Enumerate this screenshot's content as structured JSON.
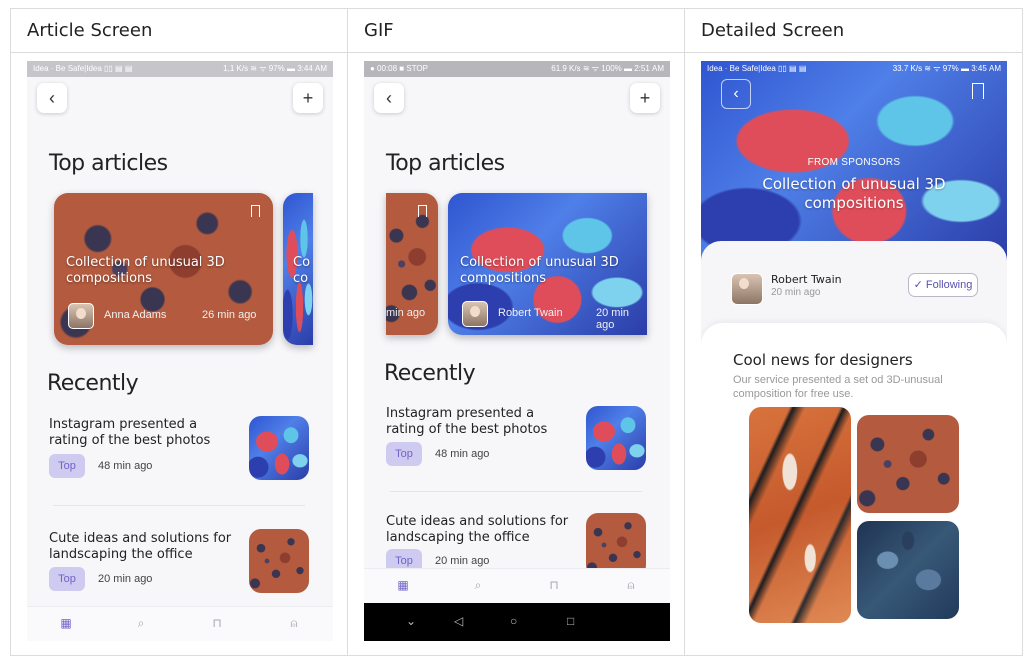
{
  "columns": [
    {
      "header": "Article Screen"
    },
    {
      "header": "GIF"
    },
    {
      "header": "Detailed Screen"
    }
  ],
  "article_screen": {
    "status": {
      "left": "Idea · Be Safe|Idea ▯▯ ▤ ▤",
      "right": "1,1 K/s ≋ ᯤ 97% ▬ 3:44 AM"
    },
    "back_icon": "chevron-left-icon",
    "add_icon": "plus-icon",
    "top_title": "Top articles",
    "featured": {
      "title": "Collection of unusual 3D compositions",
      "author": "Anna Adams",
      "time": "26 min ago"
    },
    "peek": {
      "title": "Co co"
    },
    "recently_title": "Recently",
    "items": [
      {
        "title": "Instagram presented a rating of the best photos",
        "tag": "Top",
        "time": "48 min ago"
      },
      {
        "title": "Cute ideas and solutions for landscaping the office",
        "tag": "Top",
        "time": "20 min ago"
      }
    ],
    "tabs": [
      "calendar-icon",
      "search-icon",
      "bookmark-icon",
      "user-icon"
    ]
  },
  "gif_screen": {
    "status": {
      "left": "● 00:08  ■ STOP",
      "right": "61.9 K/s ≋ ᯤ 100% ▬ 2:51 AM"
    },
    "top_title": "Top articles",
    "peek_time": "min ago",
    "featured": {
      "title": "Collection of unusual 3D compositions",
      "author": "Robert Twain",
      "time": "20 min ago"
    },
    "recently_title": "Recently",
    "items": [
      {
        "title": "Instagram presented a rating of the best photos",
        "tag": "Top",
        "time": "48 min ago"
      },
      {
        "title": "Cute ideas and solutions for landscaping the office",
        "tag": "Top",
        "time": "20 min ago"
      }
    ],
    "android_nav": [
      "⌄",
      "◁",
      "○",
      "□"
    ]
  },
  "detailed_screen": {
    "status": {
      "left": "Idea · Be Safe|Idea ▯▯ ▤ ▤",
      "right": "33.7 K/s ≋ ᯤ 97% ▬ 3:45 AM"
    },
    "kicker": "FROM SPONSORS",
    "title": "Collection of unusual 3D compositions",
    "author": "Robert Twain",
    "time": "20 min ago",
    "follow_label": "✓ Following",
    "news_title": "Cool news for designers",
    "news_desc": "Our service presented a set od 3D-unusual composition for free use."
  },
  "colors": {
    "accent": "#6f63c9",
    "tag_bg": "#cfcaf0",
    "rust": "#b35a3f",
    "marble_blue": "#2f55d0",
    "marble_red": "#e04d5a"
  }
}
